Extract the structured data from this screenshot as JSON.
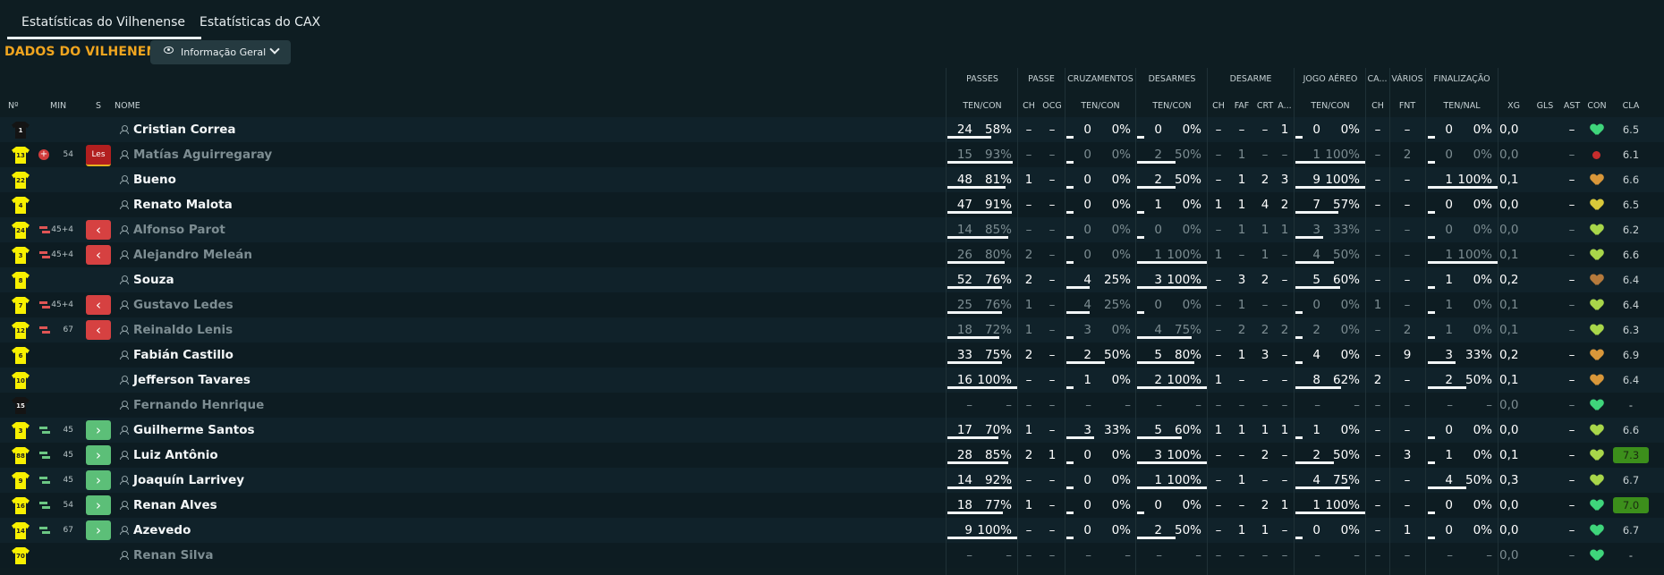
{
  "tabs": [
    "Estatísticas do Vilhenense",
    "Estatísticas do CAX"
  ],
  "team_title": "DADOS DO VILHENENSE",
  "view_dropdown": "Informação Geral",
  "columns": {
    "left": {
      "no": "Nº",
      "min": "MIN",
      "s": "S",
      "name": "NOME"
    },
    "groups": {
      "passes": "PASSES",
      "passe": "PASSE",
      "cruzamentos": "CRUZAMENTOS",
      "desarmes": "DESARMES",
      "desarme": "DESARME",
      "jogo_aereo": "JOGO AÉREO",
      "ca": "CA...",
      "varios": "VÁRIOS",
      "finalizacao": "FINALIZAÇÃO"
    },
    "sub": {
      "passes": "TEN/CON",
      "passe_ch": "CH",
      "passe_ocg": "OCG",
      "cruz": "TEN/CON",
      "des": "TEN/CON",
      "d_ch": "CH",
      "d_faf": "FAF",
      "d_crt": "CRT",
      "d_a": "A...",
      "aereo": "TEN/CON",
      "ca_ch": "CH",
      "fnt": "FNT",
      "fin": "TEN/NAL",
      "xg": "XG",
      "gls": "GLS",
      "ast": "AST",
      "con": "CON",
      "cla": "CLA"
    }
  },
  "players": [
    {
      "no": "1",
      "gk": true,
      "min": "",
      "sub": "",
      "badge": "",
      "name": "Cristian Correa",
      "dim": false,
      "p": [
        "24",
        "58%"
      ],
      "pbar": 0.58,
      "pch": "–",
      "pocg": "–",
      "c": [
        "0",
        "0%"
      ],
      "cbar": 0,
      "d": [
        "0",
        "0%"
      ],
      "dbar": 0,
      "dch": "–",
      "dfaf": "–",
      "dcrt": "–",
      "da": "1",
      "a": [
        "0",
        "0%"
      ],
      "abar": 0,
      "cach": "–",
      "fnt": "–",
      "f": [
        "0",
        "0%"
      ],
      "fbar": 0,
      "xg": "0,0",
      "gls": "",
      "ast": "–",
      "con": "green",
      "cla": "6.5",
      "hi": false
    },
    {
      "no": "13",
      "gk": false,
      "min": "54",
      "sub": "inj",
      "badge": "Les",
      "name": "Matías Aguirregaray",
      "dim": true,
      "p": [
        "15",
        "93%"
      ],
      "pbar": 0.93,
      "pch": "–",
      "pocg": "–",
      "c": [
        "0",
        "0%"
      ],
      "cbar": 0,
      "d": [
        "2",
        "50%"
      ],
      "dbar": 0.5,
      "dch": "–",
      "dfaf": "1",
      "dcrt": "–",
      "da": "–",
      "a": [
        "1",
        "100%"
      ],
      "abar": 1,
      "cach": "–",
      "fnt": "2",
      "f": [
        "0",
        "0%"
      ],
      "fbar": 0,
      "xg": "0,0",
      "gls": "",
      "ast": "–",
      "con": "red",
      "cla": "6.1",
      "hi": false
    },
    {
      "no": "22",
      "gk": false,
      "min": "",
      "sub": "",
      "badge": "",
      "name": "Bueno",
      "dim": false,
      "p": [
        "48",
        "81%"
      ],
      "pbar": 0.81,
      "pch": "1",
      "pocg": "–",
      "c": [
        "0",
        "0%"
      ],
      "cbar": 0,
      "d": [
        "2",
        "50%"
      ],
      "dbar": 0.5,
      "dch": "–",
      "dfaf": "1",
      "dcrt": "2",
      "da": "3",
      "a": [
        "9",
        "100%"
      ],
      "abar": 1,
      "cach": "–",
      "fnt": "–",
      "f": [
        "1",
        "100%"
      ],
      "fbar": 1,
      "xg": "0,1",
      "gls": "",
      "ast": "–",
      "con": "orange",
      "cla": "6.6",
      "hi": false
    },
    {
      "no": "4",
      "gk": false,
      "min": "",
      "sub": "",
      "badge": "",
      "name": "Renato Malota",
      "dim": false,
      "p": [
        "47",
        "91%"
      ],
      "pbar": 0.91,
      "pch": "–",
      "pocg": "–",
      "c": [
        "0",
        "0%"
      ],
      "cbar": 0,
      "d": [
        "1",
        "0%"
      ],
      "dbar": 0,
      "dch": "1",
      "dfaf": "1",
      "dcrt": "4",
      "da": "2",
      "a": [
        "7",
        "57%"
      ],
      "abar": 0.57,
      "cach": "–",
      "fnt": "–",
      "f": [
        "0",
        "0%"
      ],
      "fbar": 0,
      "xg": "0,0",
      "gls": "",
      "ast": "–",
      "con": "yellow",
      "cla": "6.5",
      "hi": false
    },
    {
      "no": "24",
      "gk": false,
      "min": "45+4",
      "sub": "out",
      "badge": "out",
      "name": "Alfonso Parot",
      "dim": true,
      "p": [
        "14",
        "85%"
      ],
      "pbar": 0.85,
      "pch": "–",
      "pocg": "–",
      "c": [
        "0",
        "0%"
      ],
      "cbar": 0,
      "d": [
        "0",
        "0%"
      ],
      "dbar": 0,
      "dch": "–",
      "dfaf": "1",
      "dcrt": "1",
      "da": "1",
      "a": [
        "3",
        "33%"
      ],
      "abar": 0.33,
      "cach": "–",
      "fnt": "–",
      "f": [
        "0",
        "0%"
      ],
      "fbar": 0,
      "xg": "0,0",
      "gls": "",
      "ast": "–",
      "con": "lime",
      "cla": "6.2",
      "hi": false
    },
    {
      "no": "3",
      "gk": false,
      "min": "45+4",
      "sub": "out",
      "badge": "out",
      "name": "Alejandro Meleán",
      "dim": true,
      "p": [
        "26",
        "80%"
      ],
      "pbar": 0.8,
      "pch": "2",
      "pocg": "–",
      "c": [
        "0",
        "0%"
      ],
      "cbar": 0,
      "d": [
        "1",
        "100%"
      ],
      "dbar": 1,
      "dch": "1",
      "dfaf": "–",
      "dcrt": "1",
      "da": "–",
      "a": [
        "4",
        "50%"
      ],
      "abar": 0.5,
      "cach": "–",
      "fnt": "–",
      "f": [
        "1",
        "100%"
      ],
      "fbar": 1,
      "xg": "0,1",
      "gls": "",
      "ast": "–",
      "con": "lime",
      "cla": "6.6",
      "hi": false
    },
    {
      "no": "8",
      "gk": false,
      "min": "",
      "sub": "",
      "badge": "",
      "name": "Souza",
      "dim": false,
      "p": [
        "52",
        "76%"
      ],
      "pbar": 0.76,
      "pch": "2",
      "pocg": "–",
      "c": [
        "4",
        "25%"
      ],
      "cbar": 0.25,
      "d": [
        "3",
        "100%"
      ],
      "dbar": 1,
      "dch": "–",
      "dfaf": "3",
      "dcrt": "2",
      "da": "–",
      "a": [
        "5",
        "60%"
      ],
      "abar": 0.6,
      "cach": "–",
      "fnt": "–",
      "f": [
        "1",
        "0%"
      ],
      "fbar": 0,
      "xg": "0,2",
      "gls": "",
      "ast": "–",
      "con": "brown",
      "cla": "6.4",
      "hi": false
    },
    {
      "no": "7",
      "gk": false,
      "min": "45+4",
      "sub": "out",
      "badge": "out",
      "name": "Gustavo Ledes",
      "dim": true,
      "p": [
        "25",
        "76%"
      ],
      "pbar": 0.76,
      "pch": "1",
      "pocg": "–",
      "c": [
        "4",
        "25%"
      ],
      "cbar": 0.25,
      "d": [
        "0",
        "0%"
      ],
      "dbar": 0,
      "dch": "–",
      "dfaf": "1",
      "dcrt": "–",
      "da": "–",
      "a": [
        "0",
        "0%"
      ],
      "abar": 0,
      "cach": "1",
      "fnt": "–",
      "f": [
        "1",
        "0%"
      ],
      "fbar": 0,
      "xg": "0,1",
      "gls": "",
      "ast": "–",
      "con": "lime",
      "cla": "6.4",
      "hi": false
    },
    {
      "no": "12",
      "gk": false,
      "min": "67",
      "sub": "out",
      "badge": "out",
      "name": "Reinaldo Lenis",
      "dim": true,
      "p": [
        "18",
        "72%"
      ],
      "pbar": 0.72,
      "pch": "1",
      "pocg": "–",
      "c": [
        "3",
        "0%"
      ],
      "cbar": 0,
      "d": [
        "4",
        "75%"
      ],
      "dbar": 0.75,
      "dch": "–",
      "dfaf": "2",
      "dcrt": "2",
      "da": "2",
      "a": [
        "2",
        "0%"
      ],
      "abar": 0,
      "cach": "–",
      "fnt": "2",
      "f": [
        "1",
        "0%"
      ],
      "fbar": 0,
      "xg": "0,1",
      "gls": "",
      "ast": "–",
      "con": "lime",
      "cla": "6.3",
      "hi": false
    },
    {
      "no": "6",
      "gk": false,
      "min": "",
      "sub": "",
      "badge": "",
      "name": "Fabián Castillo",
      "dim": false,
      "p": [
        "33",
        "75%"
      ],
      "pbar": 0.75,
      "pch": "2",
      "pocg": "–",
      "c": [
        "2",
        "50%"
      ],
      "cbar": 0.5,
      "d": [
        "5",
        "80%"
      ],
      "dbar": 0.8,
      "dch": "–",
      "dfaf": "1",
      "dcrt": "3",
      "da": "–",
      "a": [
        "4",
        "0%"
      ],
      "abar": 0,
      "cach": "–",
      "fnt": "9",
      "f": [
        "3",
        "33%"
      ],
      "fbar": 0.33,
      "xg": "0,2",
      "gls": "",
      "ast": "–",
      "con": "orange",
      "cla": "6.9",
      "hi": false
    },
    {
      "no": "10",
      "gk": false,
      "min": "",
      "sub": "",
      "badge": "",
      "name": "Jefferson Tavares",
      "dim": false,
      "p": [
        "16",
        "100%"
      ],
      "pbar": 1,
      "pch": "–",
      "pocg": "–",
      "c": [
        "1",
        "0%"
      ],
      "cbar": 0,
      "d": [
        "2",
        "100%"
      ],
      "dbar": 1,
      "dch": "1",
      "dfaf": "–",
      "dcrt": "–",
      "da": "–",
      "a": [
        "8",
        "62%"
      ],
      "abar": 0.62,
      "cach": "2",
      "fnt": "–",
      "f": [
        "2",
        "50%"
      ],
      "fbar": 0.5,
      "xg": "0,1",
      "gls": "",
      "ast": "–",
      "con": "orange",
      "cla": "6.4",
      "hi": false
    },
    {
      "no": "15",
      "gk": true,
      "min": "",
      "sub": "",
      "badge": "",
      "name": "Fernando Henrique",
      "dim": true,
      "p": [
        "–",
        "–"
      ],
      "pbar": 0,
      "pch": "–",
      "pocg": "–",
      "c": [
        "–",
        "–"
      ],
      "cbar": 0,
      "d": [
        "–",
        "–"
      ],
      "dbar": 0,
      "dch": "–",
      "dfaf": "–",
      "dcrt": "–",
      "da": "–",
      "a": [
        "–",
        "–"
      ],
      "abar": 0,
      "cach": "–",
      "fnt": "–",
      "f": [
        "–",
        "–"
      ],
      "fbar": 0,
      "xg": "0,0",
      "gls": "",
      "ast": "–",
      "con": "green",
      "cla": "-",
      "hi": false
    },
    {
      "no": "3",
      "gk": false,
      "min": "45",
      "sub": "in",
      "badge": "in",
      "name": "Guilherme Santos",
      "dim": false,
      "p": [
        "17",
        "70%"
      ],
      "pbar": 0.7,
      "pch": "1",
      "pocg": "–",
      "c": [
        "3",
        "33%"
      ],
      "cbar": 0.33,
      "d": [
        "5",
        "60%"
      ],
      "dbar": 0.6,
      "dch": "1",
      "dfaf": "1",
      "dcrt": "1",
      "da": "1",
      "a": [
        "1",
        "0%"
      ],
      "abar": 0,
      "cach": "–",
      "fnt": "–",
      "f": [
        "0",
        "0%"
      ],
      "fbar": 0,
      "xg": "0,0",
      "gls": "",
      "ast": "–",
      "con": "lime",
      "cla": "6.6",
      "hi": false
    },
    {
      "no": "88",
      "gk": false,
      "min": "45",
      "sub": "in",
      "badge": "in",
      "name": "Luiz Antônio",
      "dim": false,
      "p": [
        "28",
        "85%"
      ],
      "pbar": 0.85,
      "pch": "2",
      "pocg": "1",
      "c": [
        "0",
        "0%"
      ],
      "cbar": 0,
      "d": [
        "3",
        "100%"
      ],
      "dbar": 1,
      "dch": "–",
      "dfaf": "–",
      "dcrt": "2",
      "da": "–",
      "a": [
        "2",
        "50%"
      ],
      "abar": 0.5,
      "cach": "–",
      "fnt": "3",
      "f": [
        "1",
        "0%"
      ],
      "fbar": 0,
      "xg": "0,1",
      "gls": "",
      "ast": "–",
      "con": "lime",
      "cla": "7.3",
      "hi": true
    },
    {
      "no": "9",
      "gk": false,
      "min": "45",
      "sub": "in",
      "badge": "in",
      "name": "Joaquín Larrivey",
      "dim": false,
      "p": [
        "14",
        "92%"
      ],
      "pbar": 0.92,
      "pch": "–",
      "pocg": "–",
      "c": [
        "0",
        "0%"
      ],
      "cbar": 0,
      "d": [
        "1",
        "100%"
      ],
      "dbar": 1,
      "dch": "–",
      "dfaf": "1",
      "dcrt": "–",
      "da": "–",
      "a": [
        "4",
        "75%"
      ],
      "abar": 0.75,
      "cach": "–",
      "fnt": "–",
      "f": [
        "4",
        "50%"
      ],
      "fbar": 0.5,
      "xg": "0,3",
      "gls": "",
      "ast": "–",
      "con": "lime",
      "cla": "6.7",
      "hi": false
    },
    {
      "no": "16",
      "gk": false,
      "min": "54",
      "sub": "in",
      "badge": "in",
      "name": "Renan Alves",
      "dim": false,
      "p": [
        "18",
        "77%"
      ],
      "pbar": 0.77,
      "pch": "1",
      "pocg": "–",
      "c": [
        "0",
        "0%"
      ],
      "cbar": 0,
      "d": [
        "0",
        "0%"
      ],
      "dbar": 0,
      "dch": "–",
      "dfaf": "–",
      "dcrt": "2",
      "da": "1",
      "a": [
        "1",
        "100%"
      ],
      "abar": 1,
      "cach": "–",
      "fnt": "–",
      "f": [
        "0",
        "0%"
      ],
      "fbar": 0,
      "xg": "0,0",
      "gls": "",
      "ast": "–",
      "con": "green",
      "cla": "7.0",
      "hi": true
    },
    {
      "no": "14",
      "gk": false,
      "min": "67",
      "sub": "in",
      "badge": "in",
      "name": "Azevedo",
      "dim": false,
      "p": [
        "9",
        "100%"
      ],
      "pbar": 1,
      "pch": "–",
      "pocg": "–",
      "c": [
        "0",
        "0%"
      ],
      "cbar": 0,
      "d": [
        "2",
        "50%"
      ],
      "dbar": 0.5,
      "dch": "–",
      "dfaf": "1",
      "dcrt": "1",
      "da": "–",
      "a": [
        "0",
        "0%"
      ],
      "abar": 0,
      "cach": "–",
      "fnt": "1",
      "f": [
        "0",
        "0%"
      ],
      "fbar": 0,
      "xg": "0,0",
      "gls": "",
      "ast": "–",
      "con": "green",
      "cla": "6.7",
      "hi": false
    },
    {
      "no": "70",
      "gk": false,
      "min": "",
      "sub": "",
      "badge": "",
      "name": "Renan Silva",
      "dim": true,
      "p": [
        "–",
        "–"
      ],
      "pbar": 0,
      "pch": "–",
      "pocg": "–",
      "c": [
        "–",
        "–"
      ],
      "cbar": 0,
      "d": [
        "–",
        "–"
      ],
      "dbar": 0,
      "dch": "–",
      "dfaf": "–",
      "dcrt": "–",
      "da": "–",
      "a": [
        "–",
        "–"
      ],
      "abar": 0,
      "cach": "–",
      "fnt": "–",
      "f": [
        "–",
        "–"
      ],
      "fbar": 0,
      "xg": "0,0",
      "gls": "",
      "ast": "–",
      "con": "green",
      "cla": "-",
      "hi": false
    }
  ]
}
